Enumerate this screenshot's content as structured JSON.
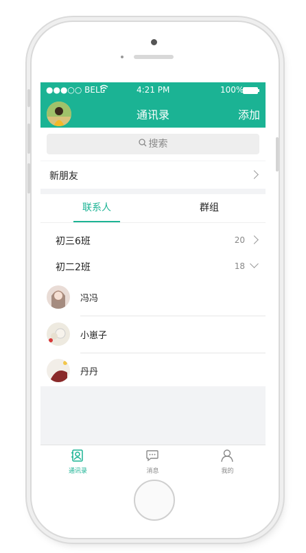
{
  "statusbar": {
    "carrier": "●●●○○ BELL",
    "time": "4:21 PM",
    "battery": "100%"
  },
  "navbar": {
    "title": "通讯录",
    "add_label": "添加"
  },
  "search": {
    "placeholder": "搜索"
  },
  "new_friend": {
    "label": "新朋友"
  },
  "tabs": [
    {
      "label": "联系人",
      "active": true
    },
    {
      "label": "群组",
      "active": false
    }
  ],
  "classes": [
    {
      "name": "初三6班",
      "count": "20",
      "expanded": false
    },
    {
      "name": "初二2班",
      "count": "18",
      "expanded": true
    }
  ],
  "contacts": [
    {
      "name": "冯冯"
    },
    {
      "name": "小崽子"
    },
    {
      "name": "丹丹"
    }
  ],
  "tabbar": [
    {
      "label": "通讯录",
      "icon": "contacts-icon",
      "active": true
    },
    {
      "label": "消息",
      "icon": "message-icon",
      "active": false
    },
    {
      "label": "我的",
      "icon": "profile-icon",
      "active": false
    }
  ],
  "colors": {
    "accent": "#1bb394",
    "inactive": "#888888"
  }
}
